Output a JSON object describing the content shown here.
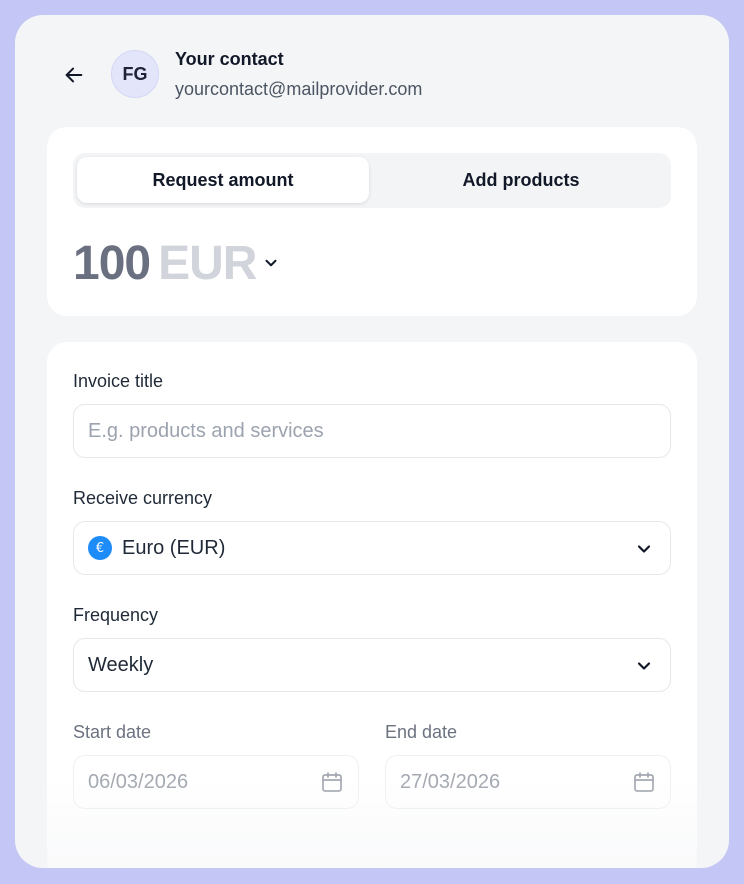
{
  "contact": {
    "initials": "FG",
    "name": "Your contact",
    "email": "yourcontact@mailprovider.com"
  },
  "tabs": [
    {
      "label": "Request amount",
      "active": true
    },
    {
      "label": "Add products",
      "active": false
    }
  ],
  "amount": {
    "value": "100",
    "currency": "EUR"
  },
  "form": {
    "invoice_title": {
      "label": "Invoice title",
      "value": "",
      "placeholder": "E.g. products and services"
    },
    "receive_currency": {
      "label": "Receive currency",
      "value": "Euro (EUR)",
      "icon_symbol": "€"
    },
    "frequency": {
      "label": "Frequency",
      "value": "Weekly"
    },
    "start_date": {
      "label": "Start date",
      "value": "06/03/2026"
    },
    "end_date": {
      "label": "End date",
      "value": "27/03/2026"
    }
  },
  "colors": {
    "page_background": "#c4c6f6",
    "panel_background": "#f4f5f7",
    "card_background": "#ffffff",
    "euro_badge": "#1d8cf8"
  },
  "icons": {
    "back": "arrow-left-icon",
    "chevron": "chevron-down-icon",
    "calendar": "calendar-icon",
    "currency": "euro-icon"
  }
}
